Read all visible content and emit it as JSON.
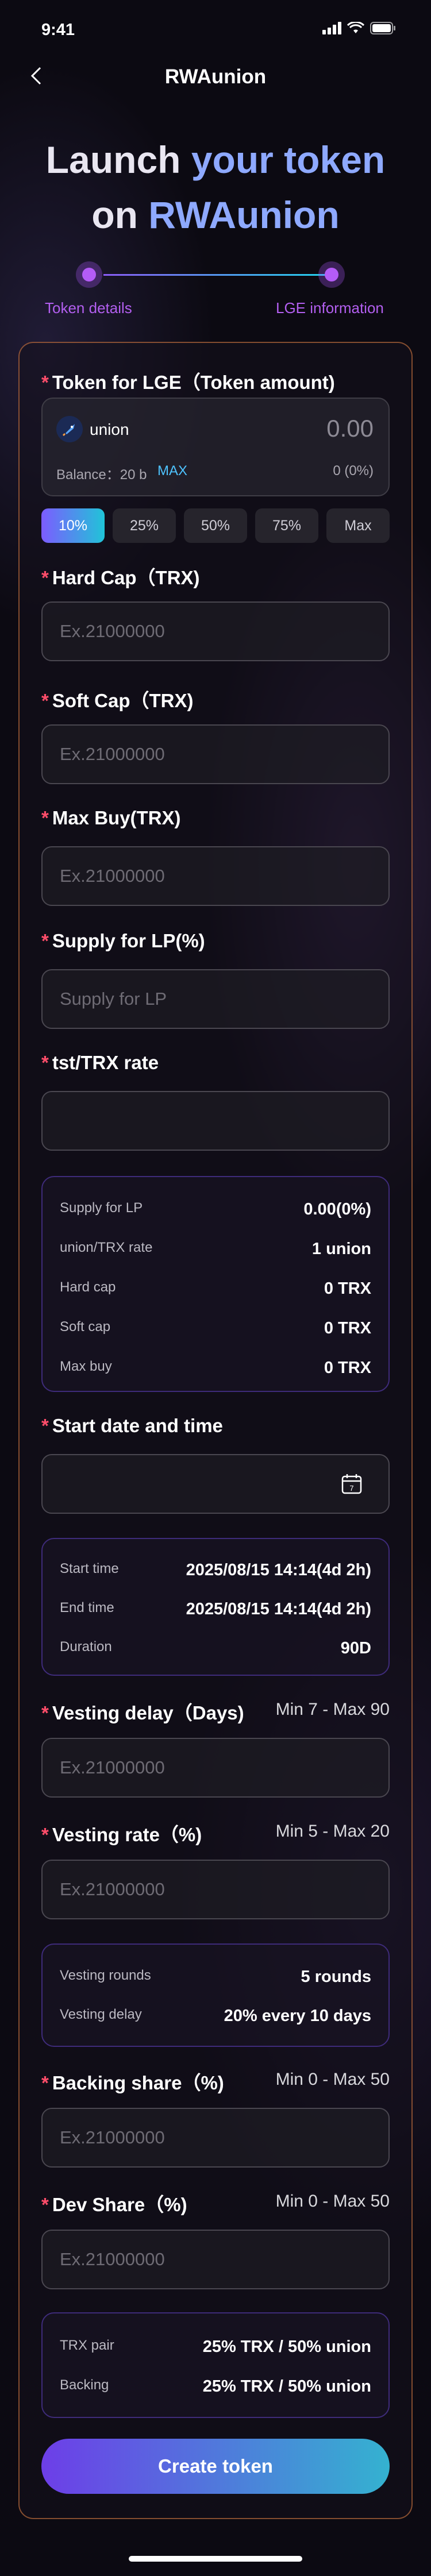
{
  "status": {
    "time": "9:41"
  },
  "nav": {
    "title": "RWAunion"
  },
  "hero": {
    "line1_a": "Launch ",
    "line1_b": "your token",
    "line2_a": "on ",
    "line2_b": "RWAunion"
  },
  "stepper": {
    "step1": "Token details",
    "step2": "LGE information"
  },
  "token_lge": {
    "label": "Token for LGE（Token amount)",
    "token_name": "union",
    "amount": "0.00",
    "balance_label": "Balance：20 b",
    "max": "MAX",
    "percent": "0 (0%)",
    "pct_options": [
      "10%",
      "25%",
      "50%",
      "75%",
      "Max"
    ],
    "selected": "10%"
  },
  "hard_cap": {
    "label": "Hard Cap（TRX)",
    "placeholder": "Ex.21000000"
  },
  "soft_cap": {
    "label": "Soft Cap（TRX)",
    "placeholder": "Ex.21000000"
  },
  "max_buy": {
    "label": "Max Buy(TRX)",
    "placeholder": "Ex.21000000"
  },
  "supply_lp": {
    "label": "Supply for LP(%)",
    "placeholder": "Supply for LP"
  },
  "rate": {
    "label": "tst/TRX rate",
    "value": ""
  },
  "summary1": {
    "rows": [
      {
        "k": "Supply for LP",
        "v": "0.00(0%)"
      },
      {
        "k": "union/TRX rate",
        "v": "1 union"
      },
      {
        "k": "Hard cap",
        "v": "0 TRX"
      },
      {
        "k": "Soft cap",
        "v": "0 TRX"
      },
      {
        "k": "Max buy",
        "v": "0 TRX"
      }
    ]
  },
  "start": {
    "label": "Start date and time",
    "value": ""
  },
  "summary2": {
    "rows": [
      {
        "k": "Start time",
        "v": "2025/08/15 14:14(4d 2h)"
      },
      {
        "k": "End time",
        "v": "2025/08/15 14:14(4d 2h)"
      },
      {
        "k": "Duration",
        "v": "90D"
      }
    ]
  },
  "vesting_delay": {
    "label": "Vesting delay（Days)",
    "hint": "Min 7 - Max 90",
    "placeholder": "Ex.21000000"
  },
  "vesting_rate": {
    "label": "Vesting rate（%)",
    "hint": "Min 5 - Max 20",
    "placeholder": "Ex.21000000"
  },
  "summary3": {
    "rows": [
      {
        "k": "Vesting rounds",
        "v": "5 rounds"
      },
      {
        "k": "Vesting delay",
        "v": "20% every 10 days"
      }
    ]
  },
  "backing": {
    "label": "Backing share（%)",
    "hint": "Min 0 - Max 50",
    "placeholder": "Ex.21000000"
  },
  "dev": {
    "label": "Dev Share（%)",
    "hint": "Min 0 - Max 50",
    "placeholder": "Ex.21000000"
  },
  "summary4": {
    "rows": [
      {
        "k": "TRX pair",
        "v": "25% TRX / 50% union"
      },
      {
        "k": "Backing",
        "v": "25% TRX / 50% union"
      }
    ]
  },
  "submit": {
    "label": "Create token"
  },
  "colors": {
    "accent": "#8ea9ff",
    "required": "#ff4d6a",
    "border_card": "#e6824666",
    "step": "#b45cf6"
  },
  "icons": {
    "back": "chevron-left-icon",
    "calendar": "calendar-icon",
    "token": "rocket-icon"
  }
}
